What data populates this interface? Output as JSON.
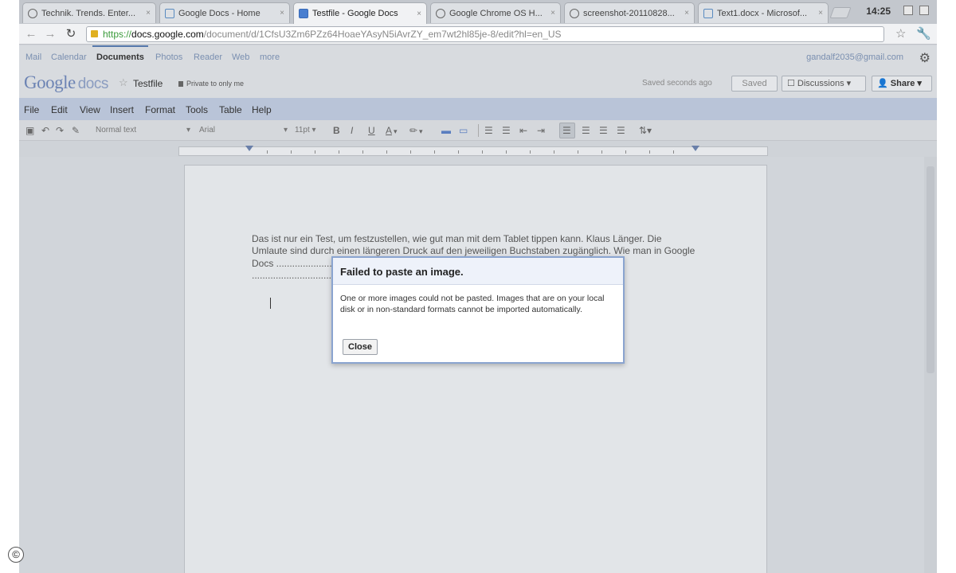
{
  "browser": {
    "tabs": [
      {
        "label": "Technik. Trends. Enter...",
        "icon": "globe-icon"
      },
      {
        "label": "Google Docs - Home",
        "icon": "drive-icon"
      },
      {
        "label": "Testfile - Google Docs",
        "icon": "doc-icon",
        "active": true
      },
      {
        "label": "Google Chrome OS H...",
        "icon": "globe-icon"
      },
      {
        "label": "screenshot-20110828...",
        "icon": "globe-icon"
      },
      {
        "label": "Text1.docx - Microsof...",
        "icon": "drive-icon"
      }
    ],
    "tab_close_glyph": "×",
    "clock": "14:25",
    "url": {
      "protocol": "https://",
      "host": "docs.google.com",
      "path": "/document/d/1CfsU3Zm6PZz64HoaeYAsyN5iAvrZY_em7wt2hl85je-8/edit?hl=en_US"
    }
  },
  "google_bar": {
    "links": [
      "Mail",
      "Calendar",
      "Documents",
      "Photos",
      "Reader",
      "Web",
      "more"
    ],
    "active_link": "Documents",
    "email": "gandalf2035@gmail.com"
  },
  "doc_header": {
    "logo_google": "Google",
    "logo_docs": "docs",
    "title": "Testfile",
    "privacy": "Private to only me",
    "saved_status": "Saved seconds ago",
    "saved_button": "Saved",
    "discussions_button": "Discussions",
    "share_button": "Share"
  },
  "menu": [
    "File",
    "Edit",
    "View",
    "Insert",
    "Format",
    "Tools",
    "Table",
    "Help"
  ],
  "format_toolbar": {
    "style": "Normal text",
    "font": "Arial",
    "size": "11pt"
  },
  "document": {
    "text": "Das ist nur ein Test, um festzustellen, wie gut man mit dem Tablet tippen kann. Klaus Länger. Die Umlaute sind durch einen längeren Druck auf den jeweiligen Buchstaben zugänglich. Wie man in Google Docs ............................................................. Anspringen einzelner Buchstaben ....................................................... nicht gefunden. Eine USB-Tastatur ..."
  },
  "dialog": {
    "title": "Failed to paste an image.",
    "message": "One or more images could not be pasted. Images that are on your local disk or in non-standard formats cannot be imported automatically.",
    "close_button": "Close"
  },
  "copyright_mark": "©"
}
